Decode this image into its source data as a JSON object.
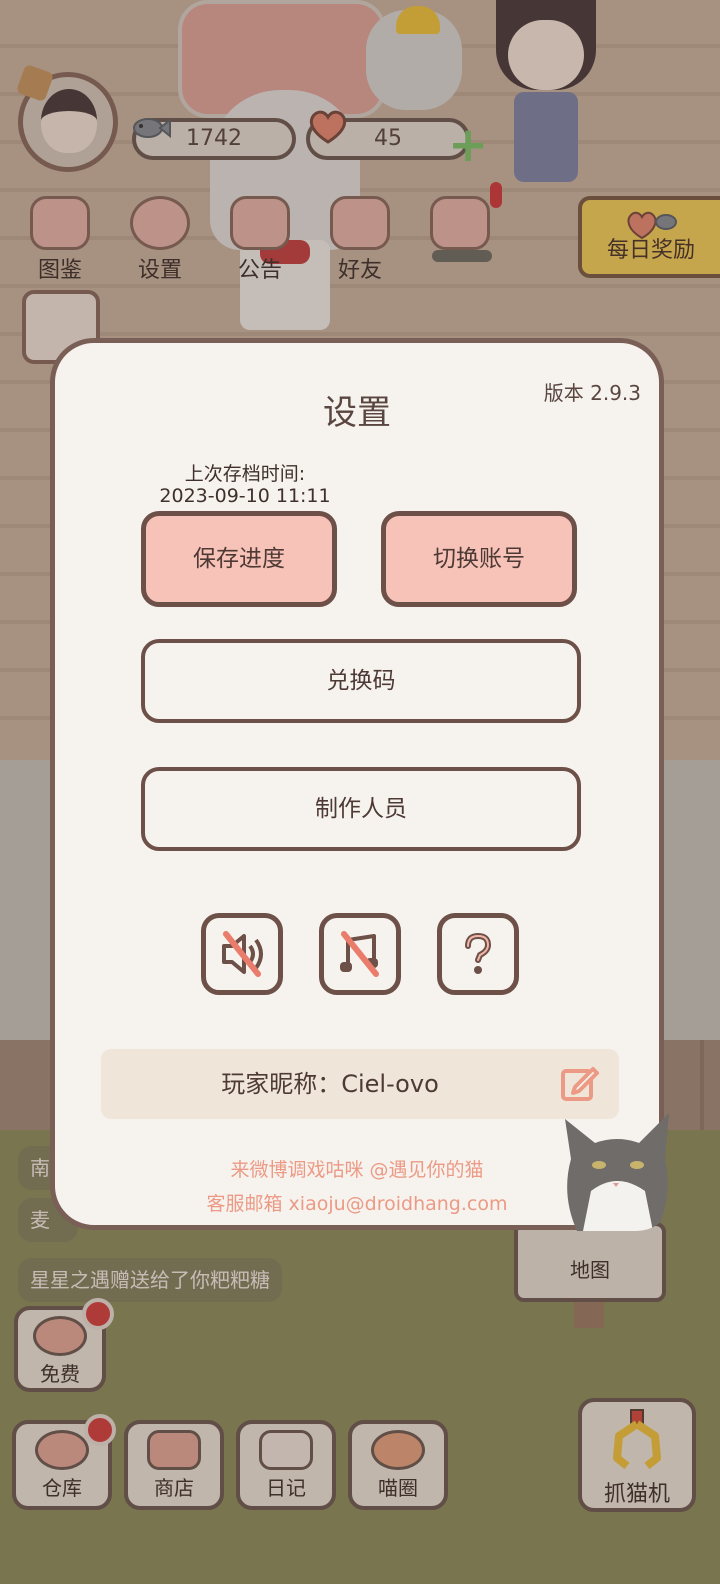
{
  "hud": {
    "avatar_icon": "player-avatar",
    "fish_count": "1742",
    "heart_count": "45",
    "fish_icon": "fish-icon",
    "heart_icon": "heart-biscuit-icon",
    "plus_icon": "plus-icon"
  },
  "menu": [
    {
      "label": "图鉴",
      "icon": "cat-head-icon"
    },
    {
      "label": "设置",
      "icon": "gear-icon"
    },
    {
      "label": "公告",
      "icon": "gift-icon"
    },
    {
      "label": "好友",
      "icon": "friends-icon"
    },
    {
      "label": "",
      "icon": "heart-mail-icon"
    }
  ],
  "daily_reward": {
    "label": "每日奖励",
    "icon": "fish-heart-icon"
  },
  "chat": {
    "lines": [
      "南",
      "麦",
      "星星之遇赠送给了你粑粑糖"
    ]
  },
  "map_button": {
    "label": "地图"
  },
  "free_button": {
    "label": "免费"
  },
  "bottom_nav": [
    {
      "label": "仓库",
      "icon": "storage-icon"
    },
    {
      "label": "商店",
      "icon": "shop-icon"
    },
    {
      "label": "日记",
      "icon": "diary-icon"
    },
    {
      "label": "喵圈",
      "icon": "planet-cat-icon"
    }
  ],
  "claw_machine": {
    "label": "抓猫机",
    "icon": "claw-icon"
  },
  "dialog": {
    "title": "设置",
    "version": "版本 2.9.3",
    "last_save_label": "上次存档时间:",
    "last_save_time": "2023-09-10 11:11",
    "save_button": "保存进度",
    "switch_account_button": "切换账号",
    "redeem_button": "兑换码",
    "credits_button": "制作人员",
    "sound_toggle_icon": "sound-muted-icon",
    "music_toggle_icon": "music-muted-icon",
    "help_icon": "help-icon",
    "nickname_label": "玩家昵称：Ciel-ovo",
    "edit_icon": "edit-icon",
    "weibo_text": "来微博调戏咕咪 @遇见你的猫",
    "email_text": "客服邮箱 xiaoju@droidhang.com"
  },
  "colors": {
    "dialog_bg": "#f6f3ee",
    "dialog_border": "#7a5f56",
    "pink_button": "#f7c2b8",
    "promo_text": "#ec9a85",
    "daily_reward_bg": "#f5cf5a",
    "notify_red": "#d6403f"
  }
}
